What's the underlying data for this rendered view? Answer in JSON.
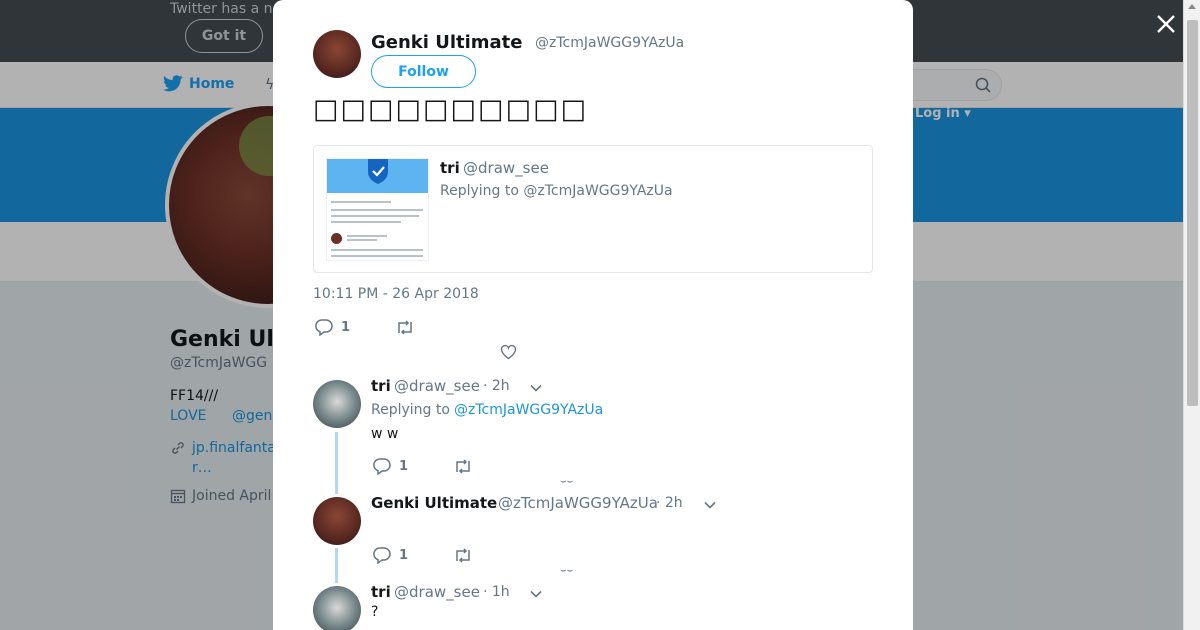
{
  "banner": {
    "text": "Twitter has a n",
    "got_it_label": "Got it"
  },
  "nav": {
    "home_label": "Home",
    "login_label": "Log in"
  },
  "profile": {
    "name": "Genki Ult",
    "handle": "@zTcmJaWGG",
    "bio": "FF14///",
    "love": "LOVE",
    "mention": "@gen",
    "url_line1": "jp.finalfanta",
    "url_line2": "r…",
    "joined": "Joined April"
  },
  "modal": {
    "author_name": "Genki Ultimate",
    "author_handle": "@zTcmJaWGG9YAzUa",
    "follow_label": "Follow",
    "tweet_text": "□□□□□□□□□□",
    "quote": {
      "name": "tri",
      "handle": "@draw_see",
      "replying": "Replying to @zTcmJaWGG9YAzUa"
    },
    "timestamp": "10:11 PM - 26 Apr 2018",
    "reply_count": "1",
    "replies": [
      {
        "name": "tri",
        "handle": "@draw_see",
        "time": "· 2h",
        "replying_prefix": "Replying to",
        "replying_handle": "@zTcmJaWGG9YAzUa",
        "text": "w w",
        "reply_count": "1"
      },
      {
        "name": "Genki Ultimate",
        "handle": "@zTcmJaWGG9YAzUa",
        "time": "· 2h",
        "text": "",
        "reply_count": "1"
      },
      {
        "name": "tri",
        "handle": "@draw_see",
        "time": "· 1h",
        "text": "?"
      }
    ]
  },
  "icons": [
    "twitter-bird-icon",
    "search-icon",
    "close-icon",
    "reply-icon",
    "retweet-icon",
    "heart-icon",
    "chevron-down-icon",
    "link-icon",
    "calendar-icon"
  ],
  "colors": {
    "accent": "#1da1f2",
    "link": "#1b95e0",
    "muted": "#657786",
    "banner": "#454c52",
    "cover": "#1b95e0",
    "thread_line": "#b3d9f2"
  }
}
